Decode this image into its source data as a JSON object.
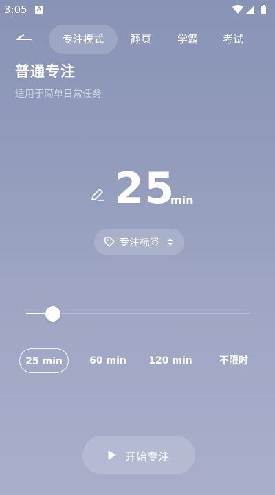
{
  "status_bar": {
    "time": "3:05",
    "notification_letter": "A"
  },
  "header": {
    "tabs": [
      {
        "label": "专注模式",
        "active": true
      },
      {
        "label": "翻页",
        "active": false
      },
      {
        "label": "学霸",
        "active": false
      },
      {
        "label": "考试",
        "active": false
      }
    ]
  },
  "mode": {
    "title": "普通专注",
    "subtitle": "适用于简单日常任务"
  },
  "timer": {
    "value": "25",
    "unit": "min"
  },
  "tag": {
    "label": "专注标签"
  },
  "slider": {
    "value_fraction": 0.12
  },
  "presets": [
    {
      "label": "25 min",
      "active": true
    },
    {
      "label": "60 min",
      "active": false
    },
    {
      "label": "120 min",
      "active": false
    },
    {
      "label": "不限时",
      "active": false
    }
  ],
  "start_button": {
    "label": "开始专注"
  },
  "icons": {
    "back": "back-arrow-icon",
    "edit": "pencil-icon",
    "tag": "tag-icon",
    "sort": "sort-arrows-icon",
    "play": "play-icon",
    "wifi": "wifi-icon",
    "signal": "signal-icon",
    "battery": "battery-icon"
  }
}
